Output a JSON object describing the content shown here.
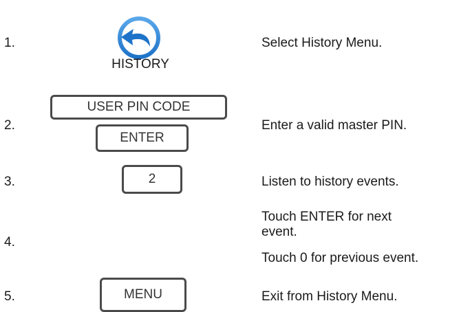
{
  "history_icon": {
    "name": "history-back-arrow-icon",
    "label": "HISTORY",
    "colors": {
      "ring": "#1e73c8",
      "arrow": "#1e73c8",
      "gradient_light": "#5aa7ea"
    }
  },
  "steps": [
    {
      "num": "1.",
      "keys": [],
      "desc": [
        "Select History Menu."
      ]
    },
    {
      "num": "2.",
      "keys": [
        "USER PIN CODE",
        "ENTER"
      ],
      "desc": [
        "Enter a valid master PIN."
      ]
    },
    {
      "num": "3.",
      "keys": [
        "2"
      ],
      "desc": [
        "Listen to history events."
      ]
    },
    {
      "num": "4.",
      "keys": [],
      "desc": [
        "Touch ENTER for next",
        "event.",
        "Touch 0 for previous event."
      ]
    },
    {
      "num": "5.",
      "keys": [
        "MENU"
      ],
      "desc": [
        "Exit from History Menu."
      ]
    }
  ]
}
